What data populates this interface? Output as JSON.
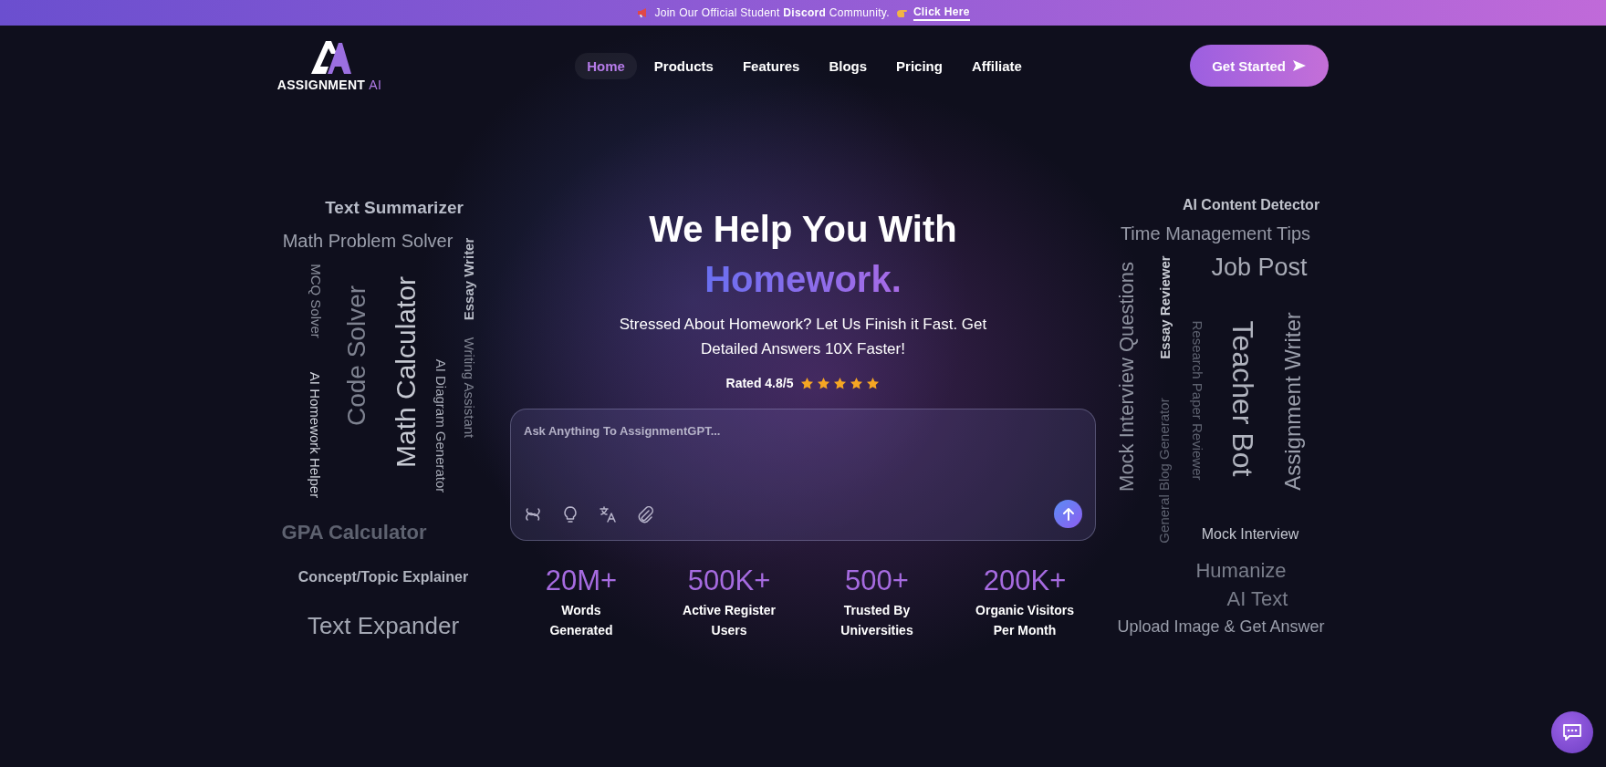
{
  "announcement": {
    "text": "Join Our Official Student **Discord** Community.",
    "link": "Click Here"
  },
  "header": {
    "logo_text": "ASSIGNMENT",
    "logo_accent": "AI",
    "nav": [
      {
        "label": "Home",
        "selected": true
      },
      {
        "label": "Products",
        "selected": false
      },
      {
        "label": "Features",
        "selected": false
      },
      {
        "label": "Blogs",
        "selected": false
      },
      {
        "label": "Pricing",
        "selected": false
      },
      {
        "label": "Affiliate",
        "selected": false
      }
    ],
    "cta": "Get Started"
  },
  "hero": {
    "title": "We Help You With",
    "highlight": "Homework.",
    "subtitle": "Stressed About Homework? Let Us Finish it Fast. Get Detailed Answers 10X Faster!",
    "rating": {
      "text": "Rated 4.8/5",
      "stars": 5
    }
  },
  "prompt": {
    "placeholder": "Ask Anything To AssignmentGPT..."
  },
  "stats": [
    {
      "value": "20M+",
      "label": [
        "Words",
        "Generated"
      ]
    },
    {
      "value": "500K+",
      "label": [
        "Active Register",
        "Users"
      ]
    },
    {
      "value": "500+",
      "label": [
        "Trusted By",
        "Universities"
      ]
    },
    {
      "value": "200K+",
      "label": [
        "Organic Visitors",
        "Per Month"
      ]
    }
  ],
  "left_cloud": [
    {
      "text": "Text Summarizer",
      "kind": "horizontal"
    },
    {
      "text": "Math Problem Solver",
      "kind": "horizontal"
    },
    {
      "text": "MCQ Solver",
      "kind": "down"
    },
    {
      "text": "AI Homework Helper",
      "kind": "down"
    },
    {
      "text": "Code Solver",
      "kind": "up"
    },
    {
      "text": "Math Calculator",
      "kind": "up"
    },
    {
      "text": "AI Diagram Generator",
      "kind": "down"
    },
    {
      "text": "Essay Writer",
      "kind": "up"
    },
    {
      "text": "Writing Assistant",
      "kind": "down"
    },
    {
      "text": "GPA Calculator",
      "kind": "horizontal"
    },
    {
      "text": "Concept/Topic Explainer",
      "kind": "horizontal"
    },
    {
      "text": "Text Expander",
      "kind": "horizontal"
    }
  ],
  "right_cloud": [
    {
      "text": "AI Content Detector",
      "kind": "horizontal"
    },
    {
      "text": "Time Management Tips",
      "kind": "horizontal"
    },
    {
      "text": "Job Post",
      "kind": "horizontal"
    },
    {
      "text": "Mock Interview Questions",
      "kind": "up"
    },
    {
      "text": "Essay Reviewer",
      "kind": "up"
    },
    {
      "text": "General Blog Generator",
      "kind": "up"
    },
    {
      "text": "Research Paper Reviewer",
      "kind": "down"
    },
    {
      "text": "Teacher Bot",
      "kind": "down"
    },
    {
      "text": "Assignment Writer",
      "kind": "up"
    },
    {
      "text": "Mock Interview",
      "kind": "horizontal"
    },
    {
      "text": "Humanize",
      "kind": "horizontal"
    },
    {
      "text": "AI Text",
      "kind": "horizontal"
    },
    {
      "text": "Upload Image & Get Answer",
      "kind": "horizontal"
    }
  ]
}
